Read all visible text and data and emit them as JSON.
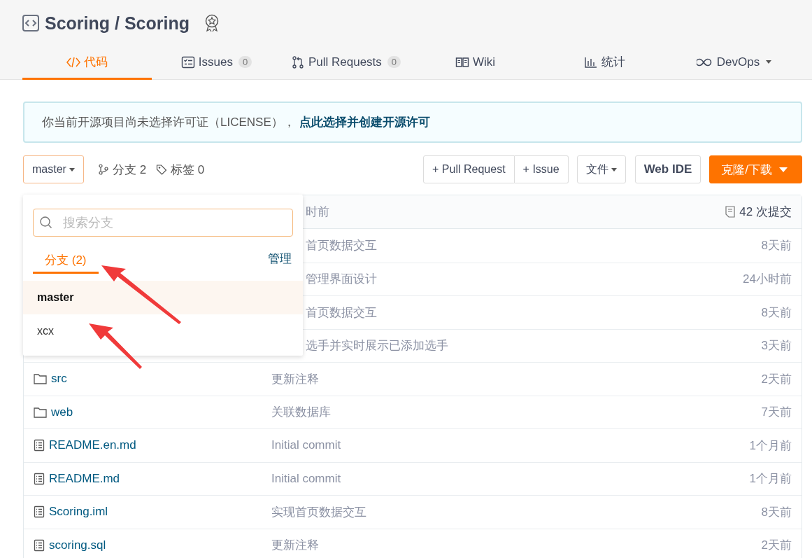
{
  "repo": {
    "title": "Scoring / Scoring"
  },
  "tabs": [
    {
      "kind": "code",
      "label": "代码",
      "selected": true
    },
    {
      "kind": "issues",
      "label": "Issues",
      "count": "0",
      "selected": false
    },
    {
      "kind": "pr",
      "label": "Pull Requests",
      "count": "0",
      "selected": false
    },
    {
      "kind": "wiki",
      "label": "Wiki",
      "selected": false
    },
    {
      "kind": "stats",
      "label": "统计",
      "selected": false
    },
    {
      "kind": "devops",
      "label": "DevOps",
      "selected": false
    }
  ],
  "notice": {
    "text": "你当前开源项目尚未选择许可证（LICENSE），",
    "link": "点此选择并创建开源许可"
  },
  "toolbar": {
    "branch": "master",
    "branches": "分支 2",
    "tags": "标签 0",
    "buttons": [
      "+ Pull Request",
      "+ Issue"
    ],
    "file_menu": "文件",
    "web_ide": "Web IDE",
    "clone": "克隆/下载"
  },
  "files": {
    "latest_time": "时前",
    "commits": "42 次提交",
    "rows": [
      {
        "message": "首页数据交互",
        "time": "8天前"
      },
      {
        "message": "管理界面设计",
        "time": "24小时前"
      },
      {
        "message": "首页数据交互",
        "time": "8天前"
      },
      {
        "message": "选手并实时展示已添加选手",
        "time": "3天前"
      },
      {
        "kind": "folder",
        "name": "src",
        "message": "更新注释",
        "time": "2天前"
      },
      {
        "kind": "folder",
        "name": "web",
        "message": "关联数据库",
        "time": "7天前"
      },
      {
        "kind": "file",
        "name": "README.en.md",
        "message": "Initial commit",
        "time": "1个月前"
      },
      {
        "kind": "file",
        "name": "README.md",
        "message": "Initial commit",
        "time": "1个月前"
      },
      {
        "kind": "file",
        "name": "Scoring.iml",
        "message": "实现首页数据交互",
        "time": "8天前"
      },
      {
        "kind": "file",
        "name": "scoring.sql",
        "message": "更新注释",
        "time": "2天前"
      }
    ]
  },
  "branch_menu": {
    "placeholder": "搜索分支",
    "tabs": [
      {
        "label": "分支 (2)",
        "selected": true
      }
    ],
    "manage": "管理",
    "branches": [
      {
        "name": "master",
        "selected": true
      },
      {
        "name": "xcx",
        "selected": false
      }
    ]
  }
}
